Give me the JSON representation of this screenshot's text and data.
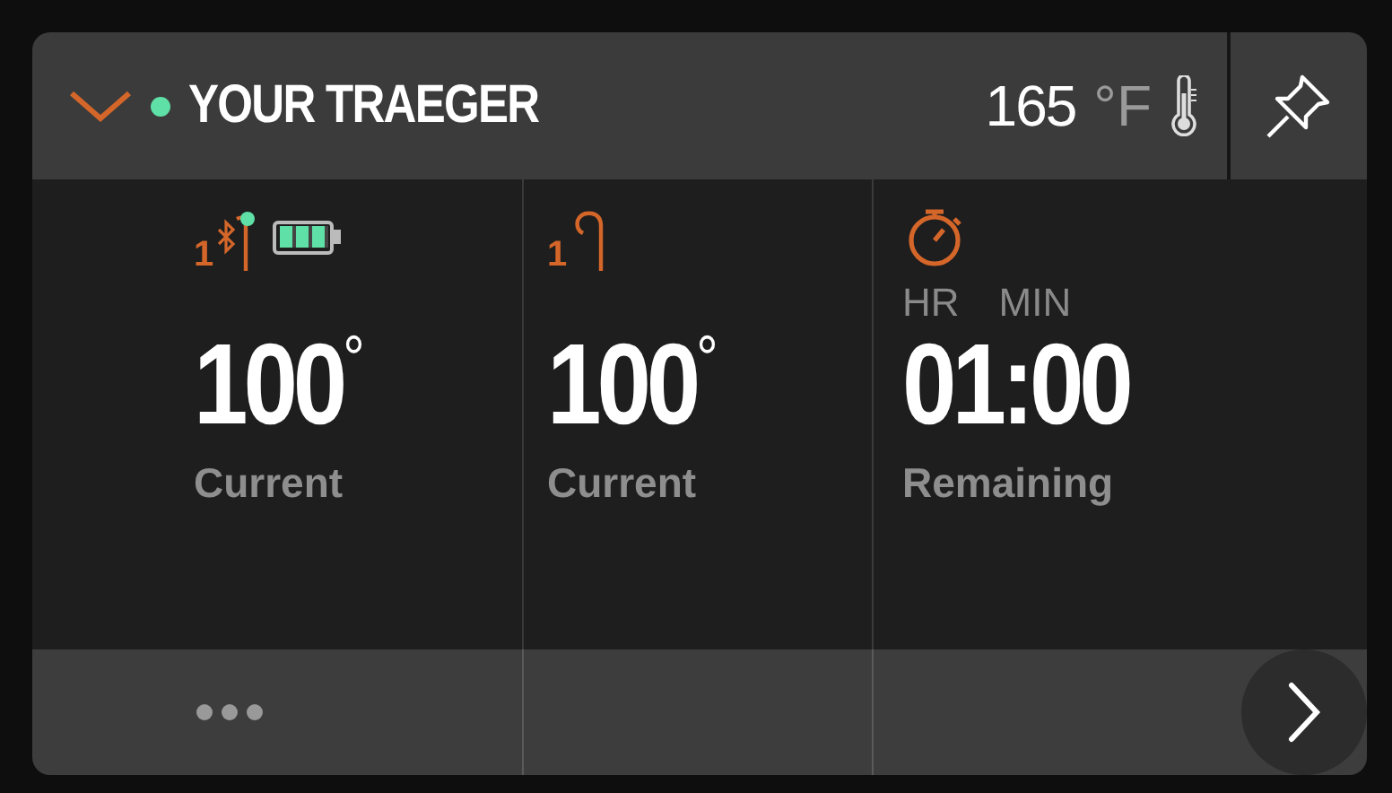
{
  "header": {
    "title": "YOUR TRAEGER",
    "connected": true,
    "temperature": "165",
    "unit": "°F"
  },
  "columns": [
    {
      "kind": "probe",
      "index": "1",
      "bluetooth": true,
      "battery": true,
      "value": "100",
      "degree": "°",
      "label": "Current"
    },
    {
      "kind": "probe",
      "index": "1",
      "bluetooth": false,
      "value": "100",
      "degree": "°",
      "label": "Current"
    },
    {
      "kind": "timer",
      "hours_label": "HR",
      "minutes_label": "MIN",
      "value": "01:00",
      "label": "Remaining"
    }
  ]
}
